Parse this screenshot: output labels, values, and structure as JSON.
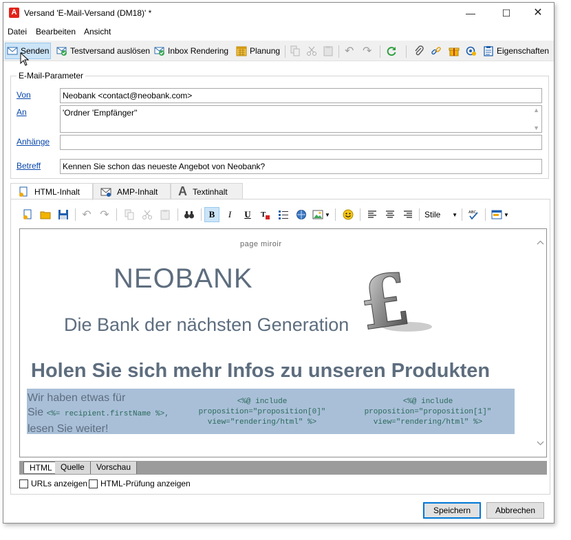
{
  "window": {
    "title": "Versand 'E-Mail-Versand (DM18)' *",
    "controls": [
      "minimize-icon",
      "maximize-icon",
      "close-icon"
    ]
  },
  "menu": [
    "Datei",
    "Bearbeiten",
    "Ansicht"
  ],
  "toolbar": {
    "send": "Senden",
    "test_send": "Testversand auslösen",
    "inbox_rendering": "Inbox Rendering",
    "planning": "Planung",
    "properties": "Eigenschaften"
  },
  "params": {
    "group_title": "E-Mail-Parameter",
    "from_label": "Von",
    "from_value": "Neobank <contact@neobank.com>",
    "to_label": "An",
    "to_value": "'Ordner 'Empfänger''",
    "attachments_label": "Anhänge",
    "attachments_value": "",
    "subject_label": "Betreff",
    "subject_value": "Kennen Sie schon das neueste Angebot von Neobank?"
  },
  "tabs": [
    "HTML-Inhalt",
    "AMP-Inhalt",
    "Textinhalt"
  ],
  "editor_toolbar": {
    "style_select": "Stile"
  },
  "content": {
    "mirror": "page miroir",
    "brand": "NEOBANK",
    "tagline": "Die Bank der nächsten Generation",
    "headline": "Holen Sie sich mehr Infos zu unseren Produkten",
    "intro_1": "Wir haben etwas für",
    "intro_2": "Sie",
    "intro_code": "<%= recipient.firstName %>,",
    "intro_3": "lesen Sie weiter!",
    "code_block_1": [
      "<%@ include",
      "proposition=\"proposition[0]\"",
      "view=\"rendering/html\" %>"
    ],
    "code_block_2": [
      "<%@ include",
      "proposition=\"proposition[1]\"",
      "view=\"rendering/html\" %>"
    ]
  },
  "view_tabs": [
    "HTML",
    "Quelle",
    "Vorschau"
  ],
  "options": {
    "show_urls": "URLs anzeigen",
    "show_html_check": "HTML-Prüfung anzeigen"
  },
  "buttons": {
    "save": "Speichern",
    "cancel": "Abbrechen"
  },
  "colors": {
    "accent": "#0078d7",
    "brand_text": "#5d6d7e",
    "selection": "#a9bfd8",
    "link": "#0645ad"
  }
}
